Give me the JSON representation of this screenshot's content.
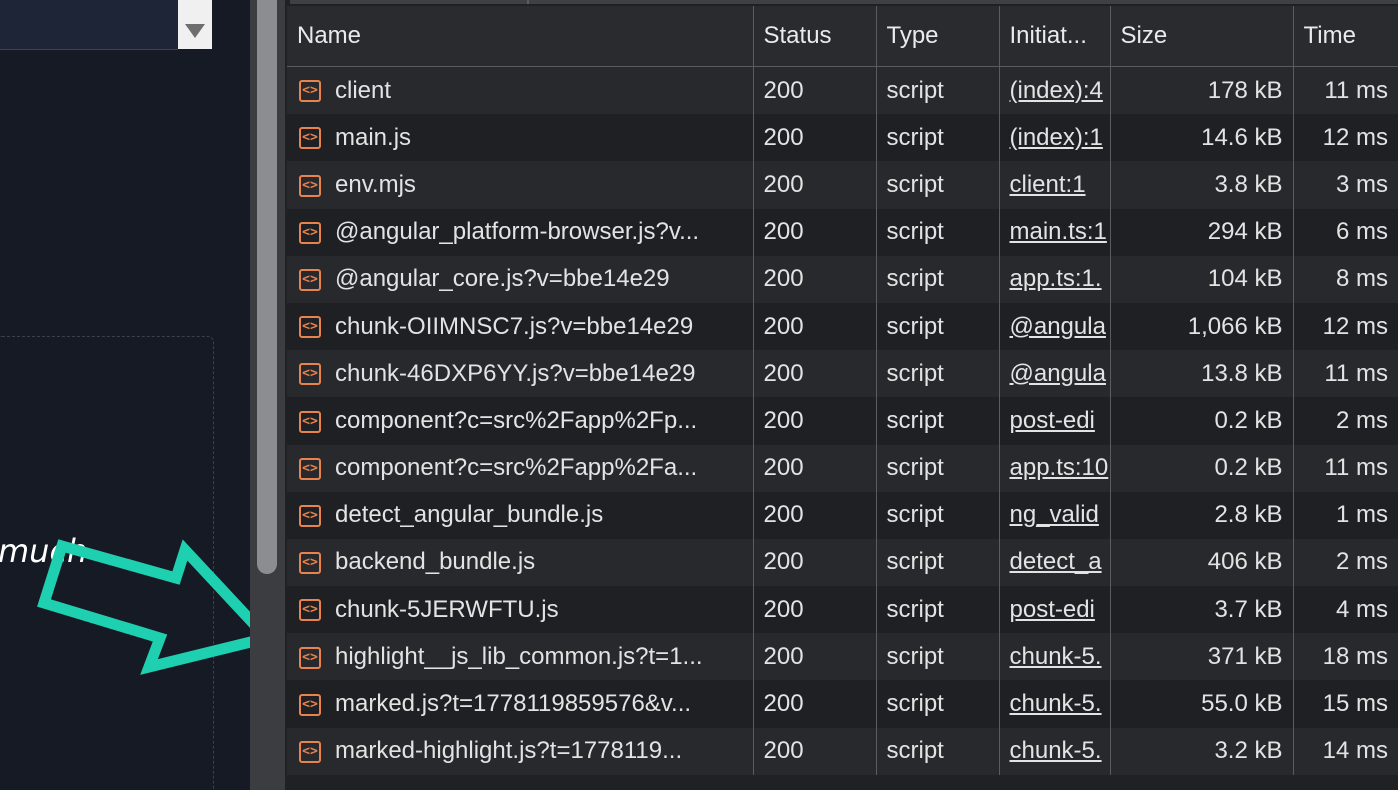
{
  "left_panel": {
    "partial_text": "much"
  },
  "network": {
    "columns": [
      "Name",
      "Status",
      "Type",
      "Initiat...",
      "Size",
      "Time"
    ],
    "rows": [
      {
        "name": "client",
        "status": "200",
        "type": "script",
        "initiator": "(index):4",
        "size": "178 kB",
        "time": "11 ms"
      },
      {
        "name": "main.js",
        "status": "200",
        "type": "script",
        "initiator": "(index):1",
        "size": "14.6 kB",
        "time": "12 ms"
      },
      {
        "name": "env.mjs",
        "status": "200",
        "type": "script",
        "initiator": "client:1",
        "size": "3.8 kB",
        "time": "3 ms"
      },
      {
        "name": "@angular_platform-browser.js?v...",
        "status": "200",
        "type": "script",
        "initiator": "main.ts:1",
        "size": "294 kB",
        "time": "6 ms"
      },
      {
        "name": "@angular_core.js?v=bbe14e29",
        "status": "200",
        "type": "script",
        "initiator": "app.ts:1.",
        "size": "104 kB",
        "time": "8 ms"
      },
      {
        "name": "chunk-OIIMNSC7.js?v=bbe14e29",
        "status": "200",
        "type": "script",
        "initiator": "@angula",
        "size": "1,066 kB",
        "time": "12 ms"
      },
      {
        "name": "chunk-46DXP6YY.js?v=bbe14e29",
        "status": "200",
        "type": "script",
        "initiator": "@angula",
        "size": "13.8 kB",
        "time": "11 ms"
      },
      {
        "name": "component?c=src%2Fapp%2Fp...",
        "status": "200",
        "type": "script",
        "initiator": "post-edi",
        "size": "0.2 kB",
        "time": "2 ms"
      },
      {
        "name": "component?c=src%2Fapp%2Fa...",
        "status": "200",
        "type": "script",
        "initiator": "app.ts:10",
        "size": "0.2 kB",
        "time": "11 ms"
      },
      {
        "name": "detect_angular_bundle.js",
        "status": "200",
        "type": "script",
        "initiator": "ng_valid",
        "size": "2.8 kB",
        "time": "1 ms"
      },
      {
        "name": "backend_bundle.js",
        "status": "200",
        "type": "script",
        "initiator": "detect_a",
        "size": "406 kB",
        "time": "2 ms"
      },
      {
        "name": "chunk-5JERWFTU.js",
        "status": "200",
        "type": "script",
        "initiator": "post-edi",
        "size": "3.7 kB",
        "time": "4 ms"
      },
      {
        "name": "highlight__js_lib_common.js?t=1...",
        "status": "200",
        "type": "script",
        "initiator": "chunk-5.",
        "size": "371 kB",
        "time": "18 ms"
      },
      {
        "name": "marked.js?t=1778119859576&v...",
        "status": "200",
        "type": "script",
        "initiator": "chunk-5.",
        "size": "55.0 kB",
        "time": "15 ms"
      },
      {
        "name": "marked-highlight.js?t=1778119...",
        "status": "200",
        "type": "script",
        "initiator": "chunk-5.",
        "size": "3.2 kB",
        "time": "14 ms"
      }
    ]
  },
  "colors": {
    "arrow": "#1ed0b0",
    "file_icon": "#e8834d",
    "row_odd": "#28292c",
    "row_even": "#1f2023"
  },
  "icons": {
    "file": "script-file-icon",
    "arrow": "pointer-arrow-annotation"
  }
}
